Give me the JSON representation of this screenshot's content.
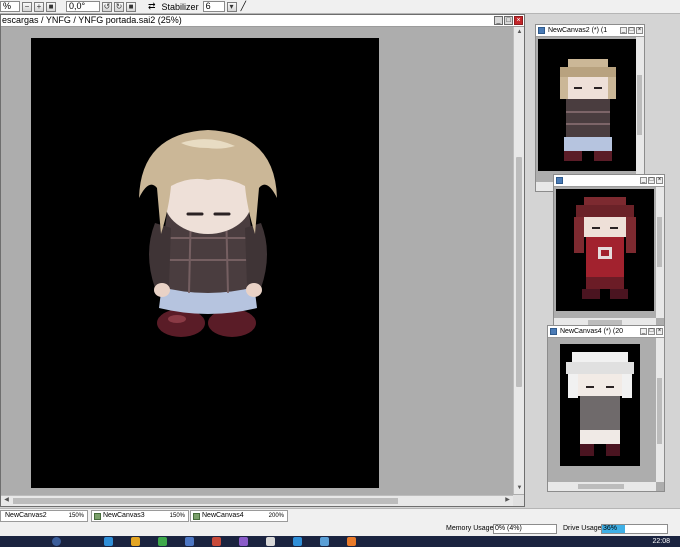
{
  "toolbar": {
    "zoom_value": "%",
    "rotation_value": "0,0°",
    "stabilizer_label": "Stabilizer",
    "stabilizer_value": "6"
  },
  "main_window": {
    "title": "escargas / YNFG / YNFG portada.sai2 (25%)"
  },
  "mini_windows": [
    {
      "title": "NewCanvas2 (*) (1"
    },
    {
      "title": ""
    },
    {
      "title": "NewCanvas4 (*) (20"
    }
  ],
  "tabs": [
    {
      "label": "NewCanvas2",
      "zoom": "150%"
    },
    {
      "label": "NewCanvas3",
      "zoom": "150%"
    },
    {
      "label": "NewCanvas4",
      "zoom": "200%"
    }
  ],
  "status": {
    "memory_label": "Memory Usage",
    "memory_value": "0% (4%)",
    "memory_fraction": 0.0,
    "drive_label": "Drive Usage",
    "drive_value": "36%",
    "drive_fraction": 0.36
  },
  "taskbar": {
    "clock": "22:08"
  },
  "colors": {
    "hair_blonde": "#cbb797",
    "sweater_plaid": "#4a3d3f",
    "skirt_blue": "#b6c4df",
    "boots_maroon": "#5a1c27",
    "hair_red": "#7d2a30",
    "dress_red": "#a2222e",
    "hair_white": "#f1f1f1",
    "drive_fill": "#3fb0e6"
  }
}
